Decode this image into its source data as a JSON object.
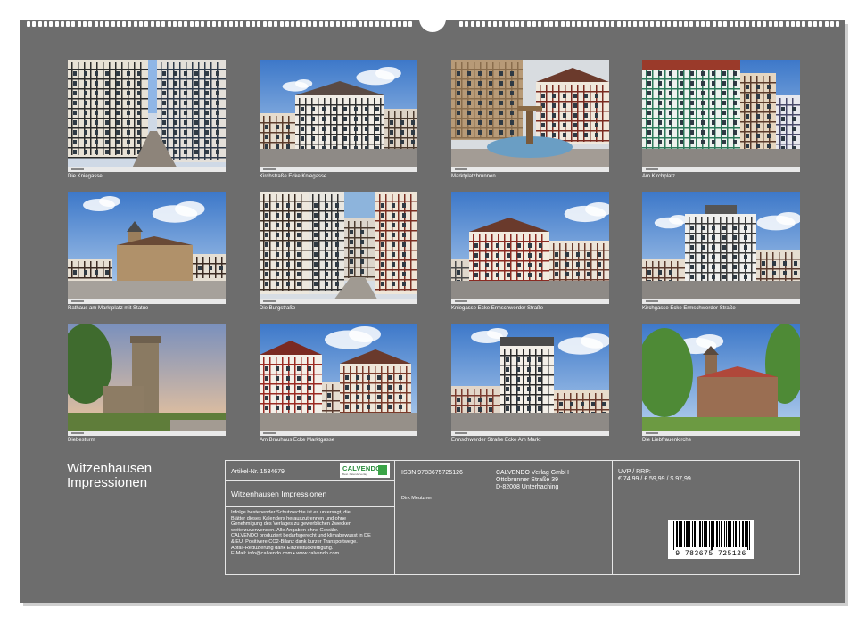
{
  "calendar": {
    "title_line1": "Witzenhausen",
    "title_line2": "Impressionen"
  },
  "photos": [
    {
      "caption": "Die Kniegasse",
      "scene": "alley"
    },
    {
      "caption": "Kirchstraße Ecke Kniegasse",
      "scene": "corner"
    },
    {
      "caption": "Marktplatzbrunnen",
      "scene": "fountain"
    },
    {
      "caption": "Am Kirchplatz",
      "scene": "row-green"
    },
    {
      "caption": "Rathaus am Marktplatz mit Statue",
      "scene": "townhall"
    },
    {
      "caption": "Die Burgstraße",
      "scene": "lane"
    },
    {
      "caption": "Kniegasse Ecke Ermschwerder Straße",
      "scene": "corner-red"
    },
    {
      "caption": "Kirchgasse Ecke Ermschwerder Straße",
      "scene": "corner-grey"
    },
    {
      "caption": "Diebesturm",
      "scene": "tower"
    },
    {
      "caption": "Am Brauhaus Ecke Marktgasse",
      "scene": "market"
    },
    {
      "caption": "Ermschwerder Straße Ecke Am Markt",
      "scene": "street"
    },
    {
      "caption": "Die Liebfrauenkirche",
      "scene": "church"
    }
  ],
  "info": {
    "article_no": "Artikel-Nr. 1534679",
    "logo_text": "CALVENDO",
    "logo_sub": "Best. Kalenderverlag",
    "product_title": "Witzenhausen Impressionen",
    "legal_text": [
      "Infolge bestehender Schutzrechte ist es untersagt, die",
      "Blätter dieses Kalenders herauszutrennen und ohne",
      "Genehmigung des Verlages zu gewerblichen Zwecken",
      "weiterzuverwenden. Alle Angaben ohne Gewähr.",
      " CALVENDO produziert bedarfsgerecht und klimabewusst in DE",
      "& EU. Positivere CO2-Bilanz dank kurzer Transportwege.",
      "Abfall-Reduzierung dank Einzelstückfertigung.",
      " E-Mail: info@calvendo.com • www.calvendo.com"
    ],
    "isbn": "ISBN 9783675725126",
    "author": "Dirk Meutzner",
    "publisher": [
      "CALVENDO Verlag GmbH",
      "Ottobrunner Straße 39",
      "D-82008 Unterhaching"
    ],
    "price_label": "UVP / RRP:",
    "prices": "€ 74,99 / £ 59,99 / $ 97,99",
    "barcode_number": "9 783675 725126"
  }
}
